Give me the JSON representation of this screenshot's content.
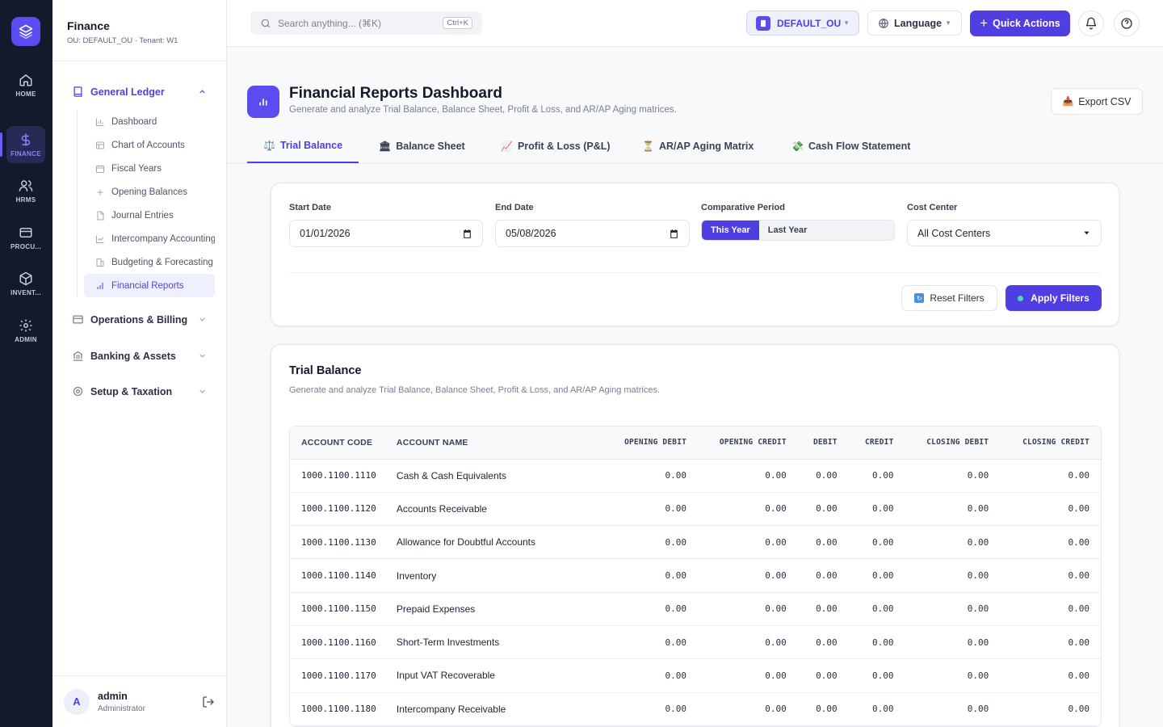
{
  "rail": {
    "items": [
      {
        "label": "HOME",
        "icon": "home-icon"
      },
      {
        "label": "FINANCE",
        "icon": "dollar-icon",
        "active": true
      },
      {
        "label": "HRMS",
        "icon": "users-icon"
      },
      {
        "label": "PROCU...",
        "icon": "card-icon"
      },
      {
        "label": "INVENT...",
        "icon": "box-icon"
      },
      {
        "label": "ADMIN",
        "icon": "gear-icon"
      }
    ]
  },
  "sidebar": {
    "title": "Finance",
    "subtitle": "OU: DEFAULT_OU · Tenant: W1",
    "groups": [
      {
        "label": "General Ledger"
      },
      {
        "label": "Operations & Billing"
      },
      {
        "label": "Banking & Assets"
      },
      {
        "label": "Setup & Taxation"
      }
    ],
    "sub_items": [
      "Dashboard",
      "Chart of Accounts",
      "Fiscal Years",
      "Opening Balances",
      "Journal Entries",
      "Intercompany Accounting",
      "Budgeting & Forecasting",
      "Financial Reports"
    ],
    "user": {
      "initial": "A",
      "name": "admin",
      "role": "Administrator"
    }
  },
  "topbar": {
    "search_placeholder": "Search anything... (⌘K)",
    "search_kbd": "Ctrl+K",
    "ou": "DEFAULT_OU",
    "language": "Language",
    "quick_actions": "Quick Actions"
  },
  "page": {
    "title": "Financial Reports Dashboard",
    "subtitle": "Generate and analyze Trial Balance, Balance Sheet, Profit & Loss, and AR/AP Aging matrices.",
    "export": "Export CSV"
  },
  "tabs": [
    {
      "label": "Trial Balance",
      "icon": "⚖️"
    },
    {
      "label": "Balance Sheet",
      "icon": "🏛"
    },
    {
      "label": "Profit & Loss (P&L)",
      "icon": "📈"
    },
    {
      "label": "AR/AP Aging Matrix",
      "icon": "⏳"
    },
    {
      "label": "Cash Flow Statement",
      "icon": "💸"
    }
  ],
  "filters": {
    "start_label": "Start Date",
    "start_value": "01/01/2026",
    "end_label": "End Date",
    "end_value": "05/08/2026",
    "period_label": "Comparative Period",
    "period_on": "This Year",
    "period_off": "Last Year",
    "cost_label": "Cost Center",
    "cost_value": "All Cost Centers",
    "reset": "Reset Filters",
    "apply": "Apply Filters"
  },
  "trial": {
    "title": "Trial Balance",
    "subtitle": "Generate and analyze Trial Balance, Balance Sheet, Profit & Loss, and AR/AP Aging matrices.",
    "headers": [
      "ACCOUNT CODE",
      "ACCOUNT NAME",
      "OPENING DEBIT",
      "OPENING CREDIT",
      "DEBIT",
      "CREDIT",
      "CLOSING DEBIT",
      "CLOSING CREDIT"
    ],
    "rows": [
      [
        "1000.1100.1110",
        "Cash & Cash Equivalents",
        "0.00",
        "0.00",
        "0.00",
        "0.00",
        "0.00",
        "0.00"
      ],
      [
        "1000.1100.1120",
        "Accounts Receivable",
        "0.00",
        "0.00",
        "0.00",
        "0.00",
        "0.00",
        "0.00"
      ],
      [
        "1000.1100.1130",
        "Allowance for Doubtful Accounts",
        "0.00",
        "0.00",
        "0.00",
        "0.00",
        "0.00",
        "0.00"
      ],
      [
        "1000.1100.1140",
        "Inventory",
        "0.00",
        "0.00",
        "0.00",
        "0.00",
        "0.00",
        "0.00"
      ],
      [
        "1000.1100.1150",
        "Prepaid Expenses",
        "0.00",
        "0.00",
        "0.00",
        "0.00",
        "0.00",
        "0.00"
      ],
      [
        "1000.1100.1160",
        "Short-Term Investments",
        "0.00",
        "0.00",
        "0.00",
        "0.00",
        "0.00",
        "0.00"
      ],
      [
        "1000.1100.1170",
        "Input VAT Recoverable",
        "0.00",
        "0.00",
        "0.00",
        "0.00",
        "0.00",
        "0.00"
      ],
      [
        "1000.1100.1180",
        "Intercompany Receivable",
        "0.00",
        "0.00",
        "0.00",
        "0.00",
        "0.00",
        "0.00"
      ]
    ]
  }
}
